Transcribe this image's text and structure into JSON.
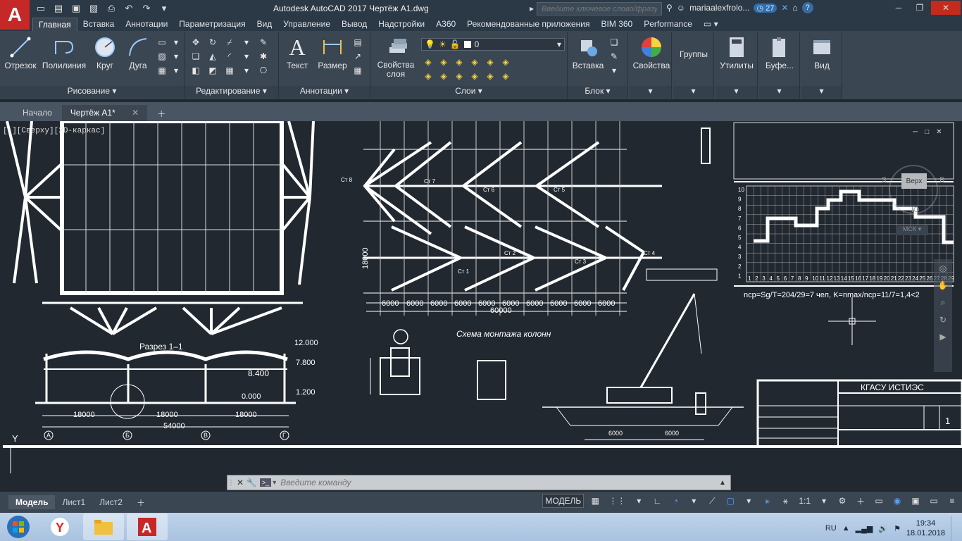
{
  "app": {
    "title": "Autodesk AutoCAD 2017    Чертёж А1.dwg",
    "logo_letter": "A",
    "search_placeholder": "Введите ключевое слово/фразу",
    "user": "mariaalexfrolo...",
    "badge_count": "27"
  },
  "ribbon_tabs": [
    "Главная",
    "Вставка",
    "Аннотации",
    "Параметризация",
    "Вид",
    "Управление",
    "Вывод",
    "Надстройки",
    "A360",
    "Рекомендованные приложения",
    "BIM 360",
    "Performance"
  ],
  "panels": {
    "draw": {
      "title": "Рисование",
      "buttons": [
        "Отрезок",
        "Полилиния",
        "Круг",
        "Дуга"
      ]
    },
    "modify": {
      "title": "Редактирование"
    },
    "annotation": {
      "title": "Аннотации",
      "buttons": [
        "Текст",
        "Размер"
      ]
    },
    "layers": {
      "title": "Слои",
      "button": "Свойства слоя",
      "current_layer": "0"
    },
    "block": {
      "title": "Блок",
      "button": "Вставка"
    },
    "properties": {
      "button": "Свойства"
    },
    "groups": {
      "button": "Группы"
    },
    "utilities": {
      "button": "Утилиты"
    },
    "clipboard": {
      "button": "Буфе..."
    },
    "view": {
      "button": "Вид"
    }
  },
  "doc_tabs": [
    "Начало",
    "Чертёж А1*"
  ],
  "viewport_label": "[-][Сверху][2D-каркас]",
  "viewcube": {
    "top": "Верх",
    "west": "З",
    "east": "В",
    "south": "Ю",
    "wcs": "МСК"
  },
  "drawing": {
    "section_title": "Разрез 1–1",
    "elev1": "12.000",
    "elev2": "7.800",
    "elev3": "8.400",
    "elev4": "1.200",
    "elev5": "0.000",
    "span1": "18000",
    "span2": "18000",
    "span3": "18000",
    "total": "54000",
    "axes_bottom": [
      "А",
      "Б",
      "В",
      "Г"
    ],
    "scheme_title": "Схема монтажа колонн",
    "spans_plan": [
      "6000",
      "6000",
      "6000",
      "6000",
      "6000",
      "6000",
      "6000",
      "6000",
      "6000",
      "6000"
    ],
    "plan_total": "60000",
    "plan_height": "18000",
    "formula": "nср=Sg/T=204/29=7 чел, K=nmax/nср=11/7=1,4<2",
    "chart_y": [
      "10",
      "9",
      "8",
      "7",
      "6",
      "5",
      "4",
      "3",
      "2",
      "1"
    ],
    "chart_x": [
      "1",
      "2",
      "3",
      "4",
      "5",
      "6",
      "7",
      "8",
      "9",
      "10",
      "11",
      "12",
      "13",
      "14",
      "15",
      "16",
      "17",
      "18",
      "19",
      "20",
      "21",
      "22",
      "23",
      "24",
      "25",
      "26",
      "27",
      "28",
      "29"
    ],
    "titleblock_org": "КГАСУ ИСТИЭС",
    "titleblock_sheet": "1",
    "crane_spans": [
      "6000",
      "6000"
    ],
    "station_labels": [
      "Ст 1",
      "Ст 2",
      "Ст 3",
      "Ст 4",
      "Ст 5",
      "Ст 6",
      "Ст 7",
      "Ст 8"
    ]
  },
  "command": {
    "placeholder": "Введите команду"
  },
  "layout_tabs": [
    "Модель",
    "Лист1",
    "Лист2"
  ],
  "status": {
    "model": "МОДЕЛЬ",
    "scale": "1:1"
  },
  "taskbar": {
    "lang": "RU",
    "time": "19:34",
    "date": "18.01.2018"
  }
}
